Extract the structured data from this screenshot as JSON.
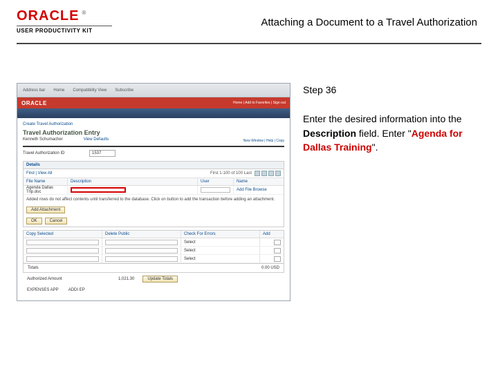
{
  "header": {
    "logo": "ORACLE",
    "tm": "®",
    "sub": "USER PRODUCTIVITY KIT",
    "title": "Attaching a Document to a Travel Authorization"
  },
  "instruction": {
    "step": "Step 36",
    "t1": "Enter the desired information into the ",
    "t2_bold": "Description",
    "t3": " field. Enter \"",
    "t4_red": "Agenda for Dallas Training",
    "t5": "\"."
  },
  "shot": {
    "chrome": {
      "m1": "Address bar",
      "m2": "Home",
      "m3": "Compatibility View",
      "m4": "Subscribe"
    },
    "oracle": {
      "logo": "ORACLE",
      "links": "Home | Add to Favorites | Sign out"
    },
    "crumb": "Create Travel Authorization",
    "h1": "Travel Authorization Entry",
    "kv": {
      "name": "Kenneth Schumacher",
      "status_lbl": "View Defaults"
    },
    "line": {
      "below_bar": "New Window | Help | Copy"
    },
    "field": {
      "lbl": "Travel Authorization ID",
      "val": "1537"
    },
    "panel": {
      "hd": "Details",
      "find": "Find | View All",
      "pager": "First 1-100 of 100 Last"
    },
    "columns": {
      "c1": "File Name",
      "c2": "Description",
      "c3": "User",
      "c4": "Name"
    },
    "row": {
      "filename": "Agenda Dallas Trip.doc",
      "browse": "Add File Browse"
    },
    "note": "Added rows do not affect contents until transferred to the database. Click on button to add the transaction before adding an attachment.",
    "btns": {
      "add": "Add Attachment",
      "ok": "OK",
      "cancel": "Cancel"
    },
    "grid": {
      "h1": "Copy Selected",
      "h2": "Delete Public",
      "h3": "Check For Errors",
      "addcol": "Add"
    },
    "rows_r": {
      "a": "Select",
      "b": "Select",
      "c": "Select"
    },
    "totals": {
      "l": "Totals",
      "r": "0.00 USD"
    },
    "sum": {
      "lbl": "Authorized Amount",
      "val": "1,021.30",
      "link": "Update Totals"
    },
    "mode": {
      "lbl": "EXPENSES APP",
      "v": "ADDI EP"
    }
  }
}
